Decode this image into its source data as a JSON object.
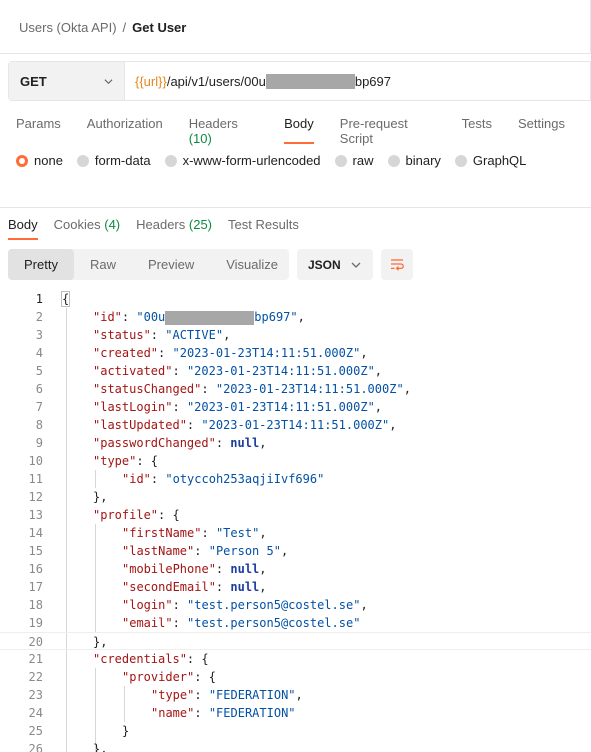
{
  "breadcrumb": {
    "parent": "Users (Okta API)",
    "separator": "/",
    "current": "Get User"
  },
  "request": {
    "method": "GET",
    "url_var": "{{url}}",
    "url_path_prefix": "/api/v1/users/00u",
    "url_suffix": "bp697"
  },
  "request_tabs": [
    {
      "label": "Params",
      "count": ""
    },
    {
      "label": "Authorization",
      "count": ""
    },
    {
      "label": "Headers",
      "count": "(10)"
    },
    {
      "label": "Body",
      "count": ""
    },
    {
      "label": "Pre-request Script",
      "count": ""
    },
    {
      "label": "Tests",
      "count": ""
    },
    {
      "label": "Settings",
      "count": ""
    }
  ],
  "body_types": [
    "none",
    "form-data",
    "x-www-form-urlencoded",
    "raw",
    "binary",
    "GraphQL"
  ],
  "response_tabs": [
    {
      "label": "Body",
      "count": ""
    },
    {
      "label": "Cookies",
      "count": "(4)"
    },
    {
      "label": "Headers",
      "count": "(25)"
    },
    {
      "label": "Test Results",
      "count": ""
    }
  ],
  "view_modes": [
    "Pretty",
    "Raw",
    "Preview",
    "Visualize"
  ],
  "format": "JSON",
  "code": {
    "line_numbers": [
      "1",
      "2",
      "3",
      "4",
      "5",
      "6",
      "7",
      "8",
      "9",
      "10",
      "11",
      "12",
      "13",
      "14",
      "15",
      "16",
      "17",
      "18",
      "19",
      "20",
      "21",
      "22",
      "23",
      "24",
      "25",
      "26"
    ],
    "id_prefix": "00u",
    "id_suffix": "bp697",
    "status": "ACTIVE",
    "created": "2023-01-23T14:11:51.000Z",
    "activated": "2023-01-23T14:11:51.000Z",
    "statusChanged": "2023-01-23T14:11:51.000Z",
    "lastLogin": "2023-01-23T14:11:51.000Z",
    "lastUpdated": "2023-01-23T14:11:51.000Z",
    "type_id": "otyccoh253aqjiIvf696",
    "firstName": "Test",
    "lastName": "Person 5",
    "login": "test.person5@costel.se",
    "email": "test.person5@costel.se",
    "provider_type": "FEDERATION",
    "provider_name": "FEDERATION"
  },
  "colors": {
    "accent": "#ff6c37",
    "count_green": "#0c8a43",
    "url_var": "#e5871a",
    "json_key": "#a31515",
    "json_string": "#0451a5"
  }
}
